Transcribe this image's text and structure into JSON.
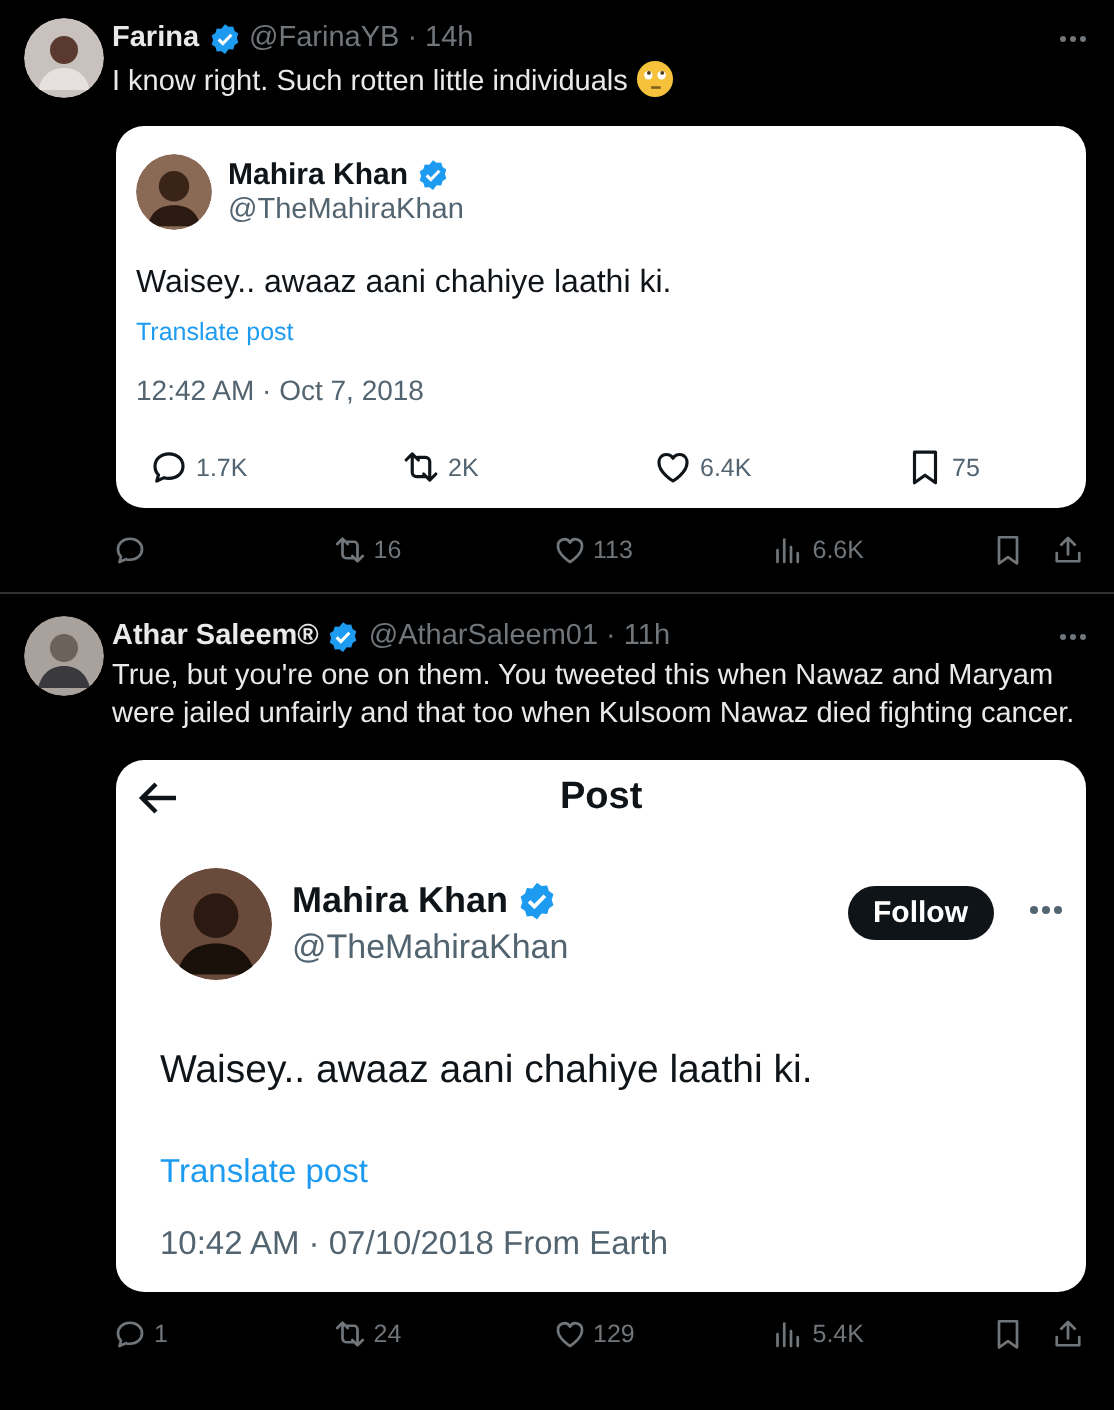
{
  "tweets": [
    {
      "name": "Farina",
      "verified": true,
      "handle": "@FarinaYB",
      "dot": "·",
      "time": "14h",
      "text": "I know right. Such rotten little individuals",
      "emoji": true,
      "quoted": {
        "kind": "embed",
        "name": "Mahira Khan",
        "verified": true,
        "handle": "@TheMahiraKhan",
        "text": "Waisey.. awaaz aani chahiye laathi ki.",
        "translate": "Translate post",
        "timestamp": "12:42 AM · Oct 7, 2018",
        "stats": [
          {
            "kind": "reply",
            "count": "1.7K"
          },
          {
            "kind": "retweet",
            "count": "2K"
          },
          {
            "kind": "like",
            "count": "6.4K"
          },
          {
            "kind": "bookmark",
            "count": "75"
          }
        ]
      },
      "actions": [
        {
          "kind": "reply"
        },
        {
          "kind": "retweet",
          "count": "16"
        },
        {
          "kind": "like",
          "count": "113"
        },
        {
          "kind": "views",
          "count": "6.6K"
        },
        {
          "kind": "bookmark"
        },
        {
          "kind": "share"
        }
      ]
    },
    {
      "name": "Athar Saleem®",
      "verified": true,
      "handle": "@AtharSaleem01",
      "dot": "·",
      "time": "11h",
      "text": "True, but you're one on them. You tweeted this when Nawaz and Maryam were jailed unfairly and that too when Kulsoom Nawaz died fighting cancer.",
      "emoji": false,
      "quoted": {
        "kind": "screenshot",
        "title": "Post",
        "name": "Mahira Khan",
        "verified": true,
        "handle": "@TheMahiraKhan",
        "follow": "Follow",
        "text": "Waisey.. awaaz aani chahiye laathi ki.",
        "translate": "Translate post",
        "timestamp": "10:42 AM · 07/10/2018 From Earth"
      },
      "actions": [
        {
          "kind": "reply",
          "count": "1"
        },
        {
          "kind": "retweet",
          "count": "24"
        },
        {
          "kind": "like",
          "count": "129"
        },
        {
          "kind": "views",
          "count": "5.4K"
        },
        {
          "kind": "bookmark"
        },
        {
          "kind": "share"
        }
      ]
    }
  ]
}
